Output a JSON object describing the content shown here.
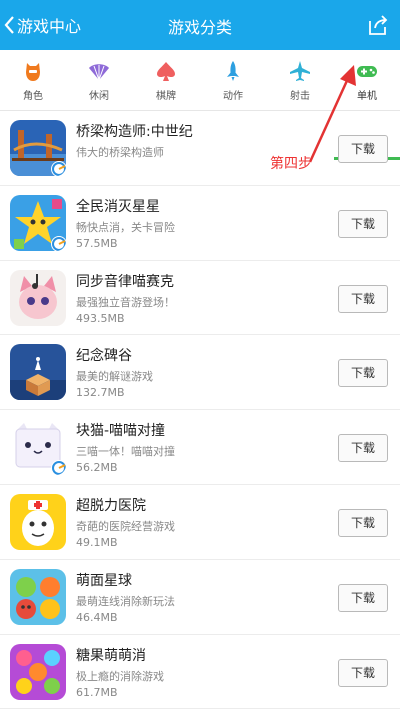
{
  "header": {
    "back_label": "游戏中心",
    "title": "游戏分类"
  },
  "tabs": [
    {
      "label": "角色",
      "icon": "character-icon",
      "color": "#f07a1e"
    },
    {
      "label": "休闲",
      "icon": "fan-icon",
      "color": "#8e6ad8"
    },
    {
      "label": "棋牌",
      "icon": "spade-icon",
      "color": "#ef5f5f"
    },
    {
      "label": "动作",
      "icon": "rocket-icon",
      "color": "#2d9fe0"
    },
    {
      "label": "射击",
      "icon": "plane-icon",
      "color": "#2fb0d6"
    },
    {
      "label": "单机",
      "icon": "gamepad-icon",
      "color": "#3fbb52"
    }
  ],
  "active_tab": "单机",
  "annotation": {
    "text": "第四步",
    "color": "#e33333"
  },
  "apps": [
    {
      "name": "桥梁构造师:中世纪",
      "desc": "伟大的桥梁构造师",
      "size": "",
      "button": "下载"
    },
    {
      "name": "全民消灭星星",
      "desc": "畅快点消，关卡冒险",
      "size": "57.5MB",
      "button": "下载"
    },
    {
      "name": "同步音律喵赛克",
      "desc": "最强独立音游登场！",
      "size": "493.5MB",
      "button": "下载"
    },
    {
      "name": "纪念碑谷",
      "desc": "最美的解谜游戏",
      "size": "132.7MB",
      "button": "下载"
    },
    {
      "name": "块猫-喵喵对撞",
      "desc": "三喵一体！喵喵对撞",
      "size": "56.2MB",
      "button": "下载"
    },
    {
      "name": "超脱力医院",
      "desc": "奇葩的医院经营游戏",
      "size": "49.1MB",
      "button": "下载"
    },
    {
      "name": "萌面星球",
      "desc": "最萌连线消除新玩法",
      "size": "46.4MB",
      "button": "下载"
    },
    {
      "name": "糖果萌萌消",
      "desc": "极上瘾的消除游戏",
      "size": "61.7MB",
      "button": "下载"
    }
  ],
  "colors": {
    "header_bg": "#1aa7ea",
    "accent": "#3fbb52"
  }
}
